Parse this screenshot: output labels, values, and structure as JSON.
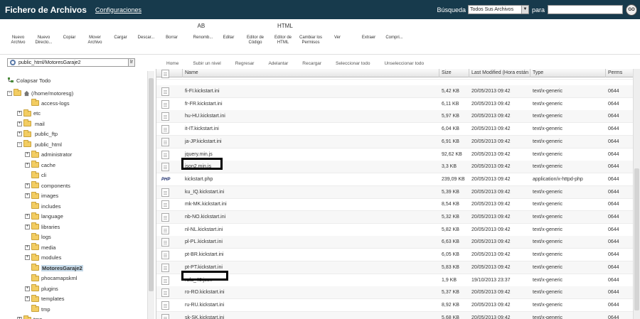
{
  "header": {
    "title": "Fichero de Archivos",
    "config_link": "Configuraciones",
    "search_label": "Búsqueda",
    "search_scope": "Todos Sus Archivos",
    "para_label": "para",
    "search_value": "",
    "go_label": "GO"
  },
  "toolbar": [
    {
      "name": "new-file-button",
      "icon": "new-file-icon",
      "label": "Nuevo Archivo"
    },
    {
      "name": "new-folder-button",
      "icon": "new-folder-icon",
      "label": "Nuevo Directo..."
    },
    {
      "name": "copy-button",
      "icon": "copy-icon",
      "label": "Copiar"
    },
    {
      "name": "move-file-button",
      "icon": "move-icon",
      "label": "Mover Archivo"
    },
    {
      "name": "upload-button",
      "icon": "upload-icon",
      "label": "Cargar"
    },
    {
      "name": "download-button",
      "icon": "download-icon",
      "label": "Descar..."
    },
    {
      "name": "delete-button",
      "icon": "delete-icon",
      "label": "Borrar"
    },
    {
      "name": "rename-button",
      "icon": "rename-icon",
      "label": "Renomb..."
    },
    {
      "name": "edit-button",
      "icon": "edit-icon",
      "label": "Editar"
    },
    {
      "name": "code-editor-button",
      "icon": "code-editor-icon",
      "label": "Editor de Código"
    },
    {
      "name": "html-editor-button",
      "icon": "html-editor-icon",
      "label": "Editor de HTML"
    },
    {
      "name": "change-permissions-button",
      "icon": "permissions-icon",
      "label": "Cambiar los Permisos"
    },
    {
      "name": "view-button",
      "icon": "view-icon",
      "label": "Ver"
    },
    {
      "name": "extract-button",
      "icon": "extract-icon",
      "label": "Extraer"
    },
    {
      "name": "compress-button",
      "icon": "compress-icon",
      "label": "Compri..."
    }
  ],
  "address": {
    "path": "public_html/MotoresGaraje2",
    "go_label": "Ir"
  },
  "nav": [
    {
      "name": "home-button",
      "icon": "home-icon",
      "label": "Home"
    },
    {
      "name": "up-level-button",
      "icon": "up-folder-icon",
      "label": "Subir un nivel"
    },
    {
      "name": "back-button",
      "icon": "back-arrow-icon",
      "label": "Regresar"
    },
    {
      "name": "forward-button",
      "icon": "forward-arrow-icon",
      "label": "Adelantar"
    },
    {
      "name": "reload-button",
      "icon": "reload-icon",
      "label": "Recargar"
    },
    {
      "name": "select-all-button",
      "icon": "checkbox-checked-icon",
      "label": "Seleccionar todo"
    },
    {
      "name": "unselect-all-button",
      "icon": "checkbox-empty-icon",
      "label": "Unseleccionar todo"
    }
  ],
  "tree": {
    "collapse_label": "Colapsar Todo",
    "root_label": "(/home/motoresg)",
    "items": [
      {
        "label": "access-logs",
        "expander": ""
      },
      {
        "label": "etc",
        "expander": "+"
      },
      {
        "label": "mail",
        "expander": "+"
      },
      {
        "label": "public_ftp",
        "expander": "+"
      },
      {
        "label": "public_html",
        "expander": "−"
      },
      {
        "label": "administrator",
        "expander": "+"
      },
      {
        "label": "cache",
        "expander": "+"
      },
      {
        "label": "cli",
        "expander": ""
      },
      {
        "label": "components",
        "expander": "+"
      },
      {
        "label": "images",
        "expander": "+"
      },
      {
        "label": "includes",
        "expander": ""
      },
      {
        "label": "language",
        "expander": "+"
      },
      {
        "label": "libraries",
        "expander": "+"
      },
      {
        "label": "logs",
        "expander": ""
      },
      {
        "label": "media",
        "expander": "+"
      },
      {
        "label": "modules",
        "expander": "+"
      },
      {
        "label": "MotoresGaraje2",
        "expander": ""
      },
      {
        "label": "phocamapskml",
        "expander": ""
      },
      {
        "label": "plugins",
        "expander": "+"
      },
      {
        "label": "templates",
        "expander": "+"
      },
      {
        "label": "tmp",
        "expander": ""
      },
      {
        "label": "tmp",
        "expander": "+"
      }
    ]
  },
  "table": {
    "columns": {
      "name": "Name",
      "size": "Size",
      "modified": "Last Modified (Hora están",
      "type": "Type",
      "perms": "Perms"
    },
    "rows": [
      {
        "name": "",
        "size": "",
        "modified": "",
        "type": "",
        "perms": "",
        "icon": "file-icon"
      },
      {
        "name": "fi-FI.kickstart.ini",
        "size": "5,42 KB",
        "modified": "20/05/2013 09:42",
        "type": "text/x-generic",
        "perms": "0644",
        "icon": "file-icon"
      },
      {
        "name": "fr-FR.kickstart.ini",
        "size": "6,11 KB",
        "modified": "20/05/2013 09:42",
        "type": "text/x-generic",
        "perms": "0644",
        "icon": "file-icon"
      },
      {
        "name": "hu-HU.kickstart.ini",
        "size": "5,97 KB",
        "modified": "20/05/2013 09:42",
        "type": "text/x-generic",
        "perms": "0644",
        "icon": "file-icon"
      },
      {
        "name": "it-IT.kickstart.ini",
        "size": "6,04 KB",
        "modified": "20/05/2013 09:42",
        "type": "text/x-generic",
        "perms": "0644",
        "icon": "file-icon"
      },
      {
        "name": "ja-JP.kickstart.ini",
        "size": "6,91 KB",
        "modified": "20/05/2013 09:42",
        "type": "text/x-generic",
        "perms": "0644",
        "icon": "file-icon"
      },
      {
        "name": "jquery.min.js",
        "size": "92,62 KB",
        "modified": "20/05/2013 09:42",
        "type": "text/x-generic",
        "perms": "0644",
        "icon": "file-icon"
      },
      {
        "name": "json2.min.js",
        "size": "3,3 KB",
        "modified": "20/05/2013 09:42",
        "type": "text/x-generic",
        "perms": "0644",
        "icon": "file-icon"
      },
      {
        "name": "kickstart.php",
        "size": "239,09 KB",
        "modified": "20/05/2013 09:42",
        "type": "application/x-httpd-php",
        "perms": "0644",
        "icon": "php-icon",
        "icon_text": "PHP"
      },
      {
        "name": "ku_IQ.kickstart.ini",
        "size": "5,39 KB",
        "modified": "20/05/2013 09:42",
        "type": "text/x-generic",
        "perms": "0644",
        "icon": "file-icon"
      },
      {
        "name": "mk-MK.kickstart.ini",
        "size": "8,54 KB",
        "modified": "20/05/2013 09:42",
        "type": "text/x-generic",
        "perms": "0644",
        "icon": "file-icon"
      },
      {
        "name": "nb-NO.kickstart.ini",
        "size": "5,32 KB",
        "modified": "20/05/2013 09:42",
        "type": "text/x-generic",
        "perms": "0644",
        "icon": "file-icon"
      },
      {
        "name": "nl-NL.kickstart.ini",
        "size": "5,82 KB",
        "modified": "20/05/2013 09:42",
        "type": "text/x-generic",
        "perms": "0644",
        "icon": "file-icon"
      },
      {
        "name": "pl-PL.kickstart.ini",
        "size": "6,63 KB",
        "modified": "20/05/2013 09:42",
        "type": "text/x-generic",
        "perms": "0644",
        "icon": "file-icon"
      },
      {
        "name": "pt-BR.kickstart.ini",
        "size": "6,05 KB",
        "modified": "20/05/2013 09:42",
        "type": "text/x-generic",
        "perms": "0644",
        "icon": "file-icon"
      },
      {
        "name": "pt-PT.kickstart.ini",
        "size": "5,83 KB",
        "modified": "20/05/2013 09:42",
        "type": "text/x-generic",
        "perms": "0644",
        "icon": "file-icon"
      },
      {
        "name": "rafa_48.json",
        "size": "1,9 KB",
        "modified": "19/10/2013 23:37",
        "type": "text/x-generic",
        "perms": "0644",
        "icon": "file-icon"
      },
      {
        "name": "ro-RO.kickstart.ini",
        "size": "5,37 KB",
        "modified": "20/05/2013 09:42",
        "type": "text/x-generic",
        "perms": "0644",
        "icon": "file-icon"
      },
      {
        "name": "ru-RU.kickstart.ini",
        "size": "8,92 KB",
        "modified": "20/05/2013 09:42",
        "type": "text/x-generic",
        "perms": "0644",
        "icon": "file-icon"
      },
      {
        "name": "sk-SK.kickstart.ini",
        "size": "5,68 KB",
        "modified": "20/05/2013 09:42",
        "type": "text/x-generic",
        "perms": "0644",
        "icon": "file-icon"
      }
    ]
  },
  "colors": {
    "header_bg": "#173a4c",
    "selected_bg": "#c5d9e8",
    "highlight_border": "#000000"
  }
}
